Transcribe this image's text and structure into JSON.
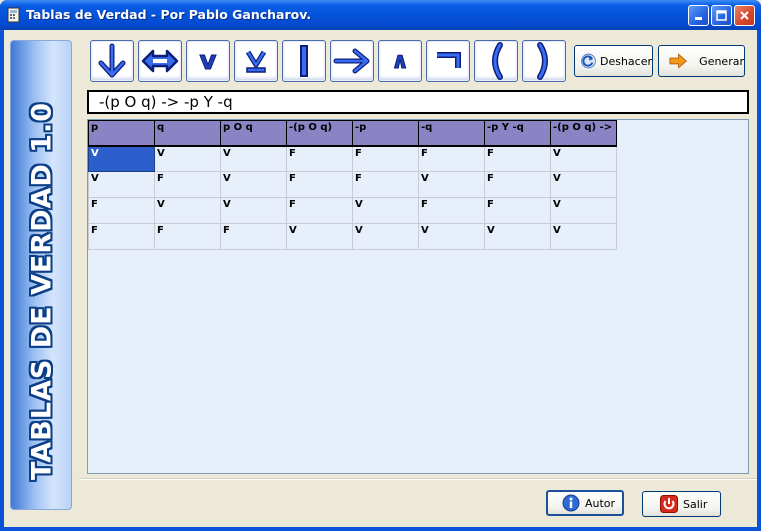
{
  "window": {
    "title": "Tablas de Verdad - Por Pablo Gancharov.",
    "accent": "#0553da"
  },
  "sidebar": {
    "banner": "TABLAS DE VERDAD 1.0"
  },
  "toolbar": {
    "operators": [
      {
        "name": "or-arrow-down",
        "glyph": "down-arrow-icon"
      },
      {
        "name": "biconditional",
        "glyph": "double-arrow-icon"
      },
      {
        "name": "or",
        "glyph": "v"
      },
      {
        "name": "xor",
        "glyph": "v-underlined"
      },
      {
        "name": "nand",
        "glyph": "|"
      },
      {
        "name": "implies",
        "glyph": "right-arrow-icon"
      },
      {
        "name": "and",
        "glyph": "∧"
      },
      {
        "name": "not",
        "glyph": "¬"
      },
      {
        "name": "open-paren",
        "glyph": "("
      },
      {
        "name": "close-paren",
        "glyph": ")"
      }
    ],
    "undo_label": "Deshacer",
    "generate_label": "Generar"
  },
  "formula": {
    "value": "-(p O q)  ->  -p Y  -q"
  },
  "table": {
    "headers": [
      "p",
      "q",
      "p O q",
      "-(p O q)",
      "-p",
      "-q",
      "-p Y -q",
      "-(p O q) ->"
    ],
    "rows": [
      [
        "V",
        "V",
        "V",
        "F",
        "F",
        "F",
        "F",
        "V"
      ],
      [
        "V",
        "F",
        "V",
        "F",
        "F",
        "V",
        "F",
        "V"
      ],
      [
        "F",
        "V",
        "V",
        "F",
        "V",
        "F",
        "F",
        "V"
      ],
      [
        "F",
        "F",
        "F",
        "V",
        "V",
        "V",
        "V",
        "V"
      ]
    ],
    "header_color": "#8a84c4",
    "selected_color": "#2c5fcb"
  },
  "footer": {
    "about_label": "Autor",
    "exit_label": "Salir"
  }
}
